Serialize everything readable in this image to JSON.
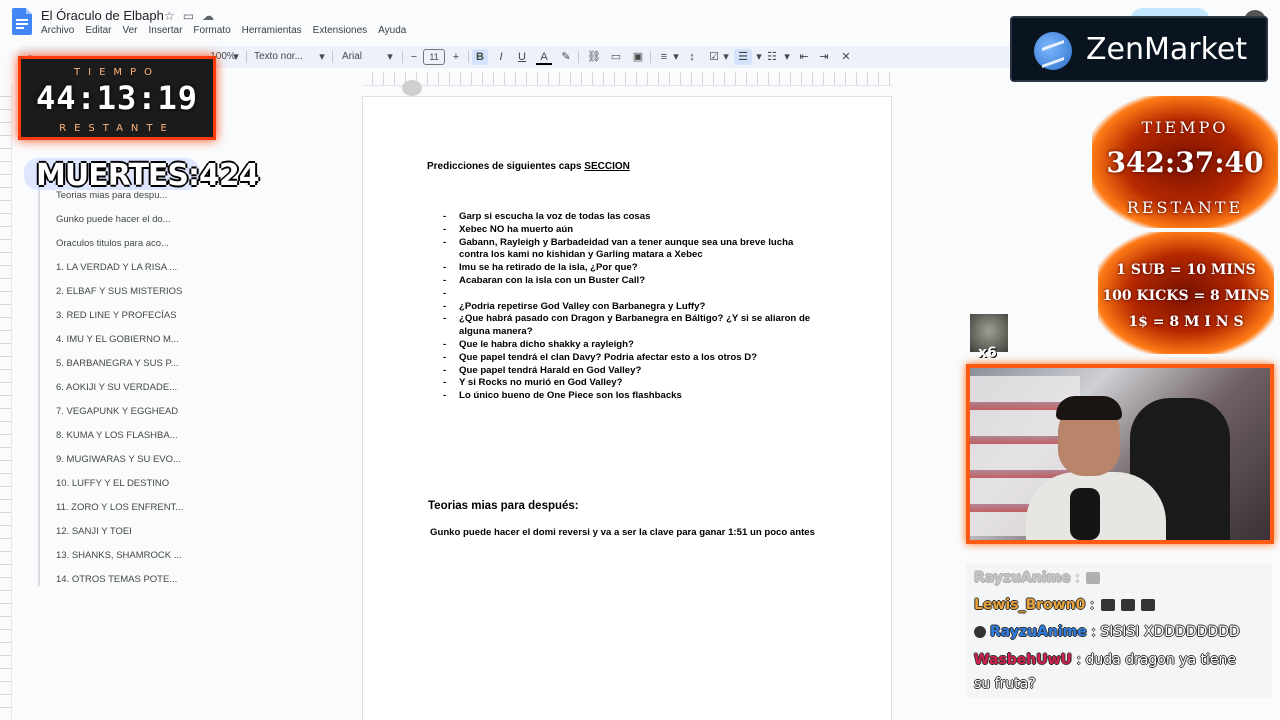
{
  "app": {
    "doc_title": "El Óraculo de Elbaph",
    "menu": [
      "Archivo",
      "Editar",
      "Ver",
      "Insertar",
      "Formato",
      "Herramientas",
      "Extensiones",
      "Ayuda"
    ]
  },
  "toolbar": {
    "zoom": "100%",
    "style": "Texto nor...",
    "font": "Arial",
    "font_size": "11",
    "bold": "B",
    "italic": "I",
    "underline": "U",
    "text_color": "A"
  },
  "outline": {
    "items": [
      "Teorias mias para despu...",
      "Gunko puede hacer el do...",
      "Oraculos titulos para aco...",
      "1. LA VERDAD Y LA RISA ...",
      "2. ELBAF Y SUS MISTERIOS",
      "3. RED LINE Y PROFECÍAS",
      "4. IMU Y EL GOBIERNO M...",
      "5. BARBANEGRA Y SUS P...",
      "6. AOKIJI Y SU VERDADE...",
      "7. VEGAPUNK Y EGGHEAD",
      "8. KUMA Y LOS FLASHBA...",
      "9. MUGIWARAS Y SU EVO...",
      "10. LUFFY Y EL DESTINO",
      "11. ZORO Y LOS ENFRENT...",
      "12. SANJI Y TOEI",
      "13. SHANKS, SHAMROCK ...",
      "14. OTROS TEMAS POTE..."
    ]
  },
  "document": {
    "heading_prefix": "Predicciones de siguientes caps ",
    "heading_underlined": "SECCION",
    "bullets": [
      "Garp si escucha la voz de todas las cosas",
      "Xebec NO ha muerto aún",
      "Gabann, Rayleigh y Barbadeidad van a tener aunque sea una breve lucha contra los kami no kishidan y Garling matara a Xebec",
      "Imu se ha retirado de la isla, ¿Por que?",
      "Acabaran con la isla con un Buster Call?",
      "",
      "¿Podria repetirse God Valley con Barbanegra y Luffy?",
      "¿Que habrá pasado con Dragon y Barbanegra en Báltigo? ¿Y si se aliaron de alguna manera?",
      "Que le habra dicho shakky a rayleigh?",
      "Que papel tendrá el clan Davy? Podria afectar esto a los otros D?",
      "Que papel tendrá Harald en God Valley?",
      "Y si Rocks no murió en God Valley?",
      "Lo único bueno de One Piece son los flashbacks"
    ],
    "section2_title": "Teorias mias para después:",
    "section2_text": "Gunko puede hacer el domi reversi y va a ser la clave para ganar 1:51 un poco antes"
  },
  "overlay": {
    "timer_label_top": "TIEMPO",
    "timer_value": "44:13:19",
    "timer_label_bottom": "RESTANTE",
    "deaths": "MUERTES:424",
    "sponsor": "ZenMarket",
    "sub_timer_top": "TIEMPO",
    "sub_timer_value": "342:37:40",
    "sub_timer_bottom": "RESTANTE",
    "rules": [
      "1 SUB = 10 MINS",
      "100 KICKS = 8 MINS",
      "1$ = 8 M I N S"
    ],
    "emote_count": "x6"
  },
  "chat": [
    {
      "user": "RayzuAnime",
      "sep": " :",
      "text": "",
      "color": "#6b6b6b",
      "faded": true
    },
    {
      "user": "Lewis_Brown0",
      "sep": " :",
      "text": "",
      "color": "#e8a33a",
      "faded": false
    },
    {
      "user": "RayzuAnime",
      "sep": " :",
      "text": " SISISI XDDDDDDDD",
      "color": "#2f7de1",
      "faded": false
    },
    {
      "user": "WasbehUwU",
      "sep": " :",
      "text": " duda   dragon ya tiene",
      "color": "#d3204f",
      "faded": false
    },
    {
      "user": "",
      "sep": "",
      "text": "su fruta?",
      "color": "#ffffff",
      "faded": false
    }
  ],
  "colors": {
    "accent_blue": "#4285f4",
    "toolbar_bg": "#edf2fa",
    "fire_orange": "#ff5a14"
  }
}
